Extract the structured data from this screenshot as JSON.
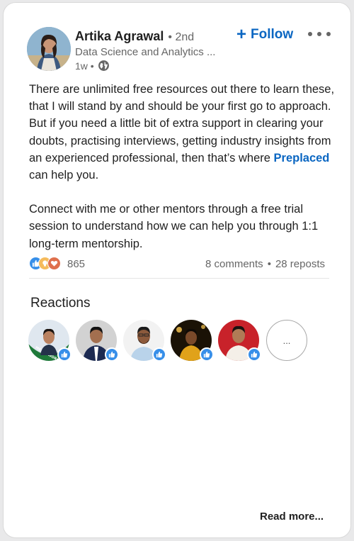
{
  "author": {
    "name": "Artika Agrawal",
    "degree": "• 2nd",
    "headline": "Data Science and Analytics ...",
    "time": "1w •"
  },
  "actions": {
    "follow_icon": "+",
    "follow_label": "Follow"
  },
  "post": {
    "paragraph1_text": "There are unlimited free resources out there to learn these, that I will stand by and should be your first go to approach. But if you need a little bit of extra support in clearing your doubts, practising interviews, getting industry insights from an experienced professional, then that’s where ",
    "paragraph1_link": "Preplaced",
    "paragraph1_end": " can help you.",
    "paragraph2": "Connect with me or other mentors through a free trial session to understand how we can help you through 1:1 long-term mentorship."
  },
  "social": {
    "reaction_count": "865",
    "comments": "8 comments",
    "separator": "•",
    "reposts": "28 reposts",
    "reaction_types": [
      "like-icon",
      "idea-icon",
      "love-icon"
    ]
  },
  "reactions_section": {
    "title": "Reactions",
    "more_label": "...",
    "reactors": [
      "avatar-1",
      "avatar-2",
      "avatar-3",
      "avatar-4",
      "avatar-5"
    ],
    "mentoworq_badge_text": "MENTOWORQ"
  },
  "footer": {
    "read_more": "Read more..."
  },
  "colors": {
    "accent": "#0a66c2",
    "like": "#378fe9",
    "idea": "#f5bb5c",
    "love": "#df704d",
    "muted_text": "#666666"
  }
}
